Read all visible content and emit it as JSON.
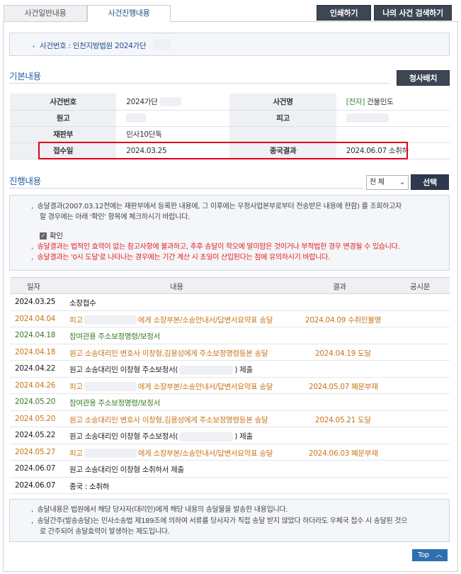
{
  "tabs": [
    {
      "label": "사건일반내용"
    },
    {
      "label": "사건진행내용"
    }
  ],
  "buttons": {
    "print": "인쇄하기",
    "search": "나의 사건 검색하기",
    "select": "선택",
    "delivery": "청사배치",
    "top": "Top"
  },
  "case_header": {
    "text": "사건번호 : 인천지방법원 2024가단"
  },
  "basic": {
    "title": "기본내용",
    "rows": [
      {
        "h1": "사건번호",
        "v1": "2024가단",
        "h2": "사건명",
        "tag": "[전자]",
        "v2": "건물인도"
      },
      {
        "h1": "원고",
        "v1": "",
        "h2": "피고",
        "v2": ""
      },
      {
        "h1": "재판부",
        "v1": "민사10단독",
        "h2": "",
        "v2": ""
      },
      {
        "h1": "접수일",
        "v1": "2024.03.25",
        "h2": "종국결과",
        "v2": "2024.06.07 소취하"
      }
    ]
  },
  "progress": {
    "title": "진행내용",
    "filter": "전 체"
  },
  "notice": {
    "line1": "송달결과(2007.03.12전에는 재판부에서 등록한 내용에, 그 이후에는 우정사업본부로부터 전송받은 내용에 한함) 를 조회하고자",
    "line2": "할 경우에는 아래 '확인' 항목에 체크하시기 바랍니다.",
    "confirm": "확인",
    "warn1": "송달결과는 법적인 효력이 없는 참고사항에 불과하고, 추후 송달이 착오에 말미암은 것이거나 부적법한 경우 변경될 수 있습니다.",
    "warn2": "송달결과는 '0시 도달'로 나타나는 경우에는 기간 계산 시 초일이 산입된다는 점에 유의하시기 바랍니다."
  },
  "table": {
    "headers": {
      "date": "일자",
      "content": "내용",
      "result": "결과",
      "notice": "공시문"
    },
    "rows": [
      {
        "date": "2024.03.25",
        "pre": "소장접수",
        "post": "",
        "result": "",
        "color": "black"
      },
      {
        "date": "2024.04.04",
        "pre": "피고",
        "post": "에게 소장부본/소송안내서/답변서요약표 송달",
        "result": "2024.04.09 수취인불명",
        "color": "orange"
      },
      {
        "date": "2024.04.18",
        "pre": "참여관용 주소보정명령/보정서",
        "post": "",
        "result": "",
        "color": "green"
      },
      {
        "date": "2024.04.18",
        "pre": "원고 소송대리인 변호사 이창형,김용성에게 주소보정명령등본 송달",
        "post": "",
        "result": "2024.04.19 도달",
        "color": "orange"
      },
      {
        "date": "2024.04.22",
        "pre": "원고 소송대리인 이창형 주소보정서(",
        "post": ") 제출",
        "result": "",
        "color": "dark"
      },
      {
        "date": "2024.04.26",
        "pre": "피고",
        "post": "에게 소장부본/소송안내서/답변서요약표 송달",
        "result": "2024.05.07 폐문부재",
        "color": "orange"
      },
      {
        "date": "2024.05.20",
        "pre": "참여관용 주소보정명령/보정서",
        "post": "",
        "result": "",
        "color": "green"
      },
      {
        "date": "2024.05.20",
        "pre": "원고 소송대리인 변호사 이창형,김용성에게 주소보정명령등본 송달",
        "post": "",
        "result": "2024.05.21 도달",
        "color": "orange"
      },
      {
        "date": "2024.05.22",
        "pre": "원고 소송대리인 이창형 주소보정서(",
        "post": ") 제출",
        "result": "",
        "color": "dark"
      },
      {
        "date": "2024.05.27",
        "pre": "피고",
        "post": "에게 소장부본/소송안내서/답변서요약표 송달",
        "result": "2024.06.03 폐문부재",
        "color": "orange"
      },
      {
        "date": "2024.06.07",
        "pre": "원고 소송대리인 이창형 소취하서 제출",
        "post": "",
        "result": "",
        "color": "dark"
      },
      {
        "date": "2024.06.07",
        "pre": "종국 : 소취하",
        "post": "",
        "result": "",
        "color": "black"
      }
    ]
  },
  "footer": {
    "line1": "송달내용은 법원에서 해당 당사자(대리인)에게 해당 내용의 송달물을 발송한 내용입니다.",
    "line2": "송달간주(발송송달)는 민사소송법 제189조에 의하여 서류를 당사자가 직접 송달 받지 않았다 하더라도 우체국 접수 시 송달된 것으",
    "line3": "로 간주되어 송달효력이 발생하는 제도입니다."
  }
}
